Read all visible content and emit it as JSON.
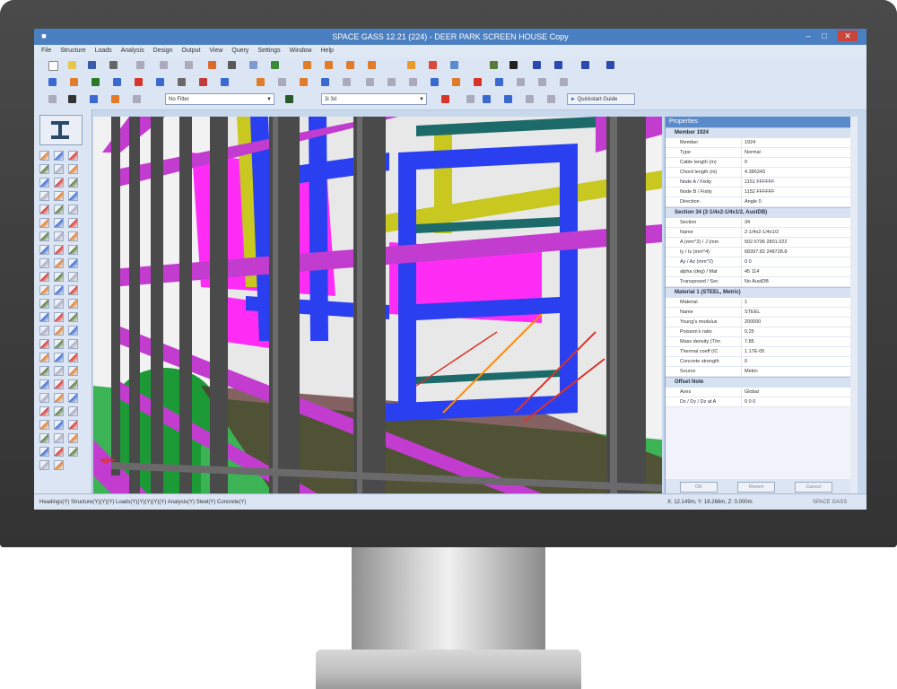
{
  "window": {
    "title": "SPACE GASS 12.21 (224) - DEER PARK SCREEN HOUSE Copy",
    "icon": "app-icon"
  },
  "menu": [
    "File",
    "Structure",
    "Loads",
    "Analysis",
    "Design",
    "Output",
    "View",
    "Query",
    "Settings",
    "Window",
    "Help"
  ],
  "toolbar": {
    "filter1": "No Filter",
    "filter2": "3i 3d",
    "quick_guide": "Quickstart Guide"
  },
  "properties": {
    "title": "Properties",
    "groups": [
      {
        "name": "Member 1924",
        "rows": [
          {
            "key": "Member",
            "value": "1924"
          },
          {
            "key": "Type",
            "value": "Normal"
          },
          {
            "key": "Cable length (m)",
            "value": "0"
          },
          {
            "key": "Chord length (m)",
            "value": "4.386343"
          },
          {
            "key": "Node A / Fixity",
            "value": "1151    FFFFFF"
          },
          {
            "key": "Node B / Fixity",
            "value": "1152    FFFFFF"
          },
          {
            "key": "Direction",
            "value": "Angle   0"
          }
        ]
      },
      {
        "name": "Section 34 (2-1/4x2-1/4x1/2, AustDB)",
        "rows": [
          {
            "key": "Section",
            "value": "34"
          },
          {
            "key": "Name",
            "value": "2-1/4x2-1/4x1/2"
          },
          {
            "key": "A (mm^2) / J (mm",
            "value": "502.5796    2801.022"
          },
          {
            "key": "Iy / Iz (mm^4)",
            "value": "68397.82    248728.8"
          },
          {
            "key": "Ay / Az (mm^2)",
            "value": "0    0"
          },
          {
            "key": "alpha (deg) / Mat",
            "value": "45    114"
          },
          {
            "key": "Transposed / Sec",
            "value": "No    AustDB"
          }
        ]
      },
      {
        "name": "Material 1 (STEEL, Metric)",
        "rows": [
          {
            "key": "Material",
            "value": "1"
          },
          {
            "key": "Name",
            "value": "STEEL"
          },
          {
            "key": "Young's modulus",
            "value": "200000"
          },
          {
            "key": "Poisson's ratio",
            "value": "0.25"
          },
          {
            "key": "Mass density (T/m",
            "value": "7.85"
          },
          {
            "key": "Thermal coeff (/C",
            "value": "1.17E-05"
          },
          {
            "key": "Concrete strength",
            "value": "0"
          },
          {
            "key": "Source",
            "value": "Metric"
          }
        ]
      },
      {
        "name": "Offset Note",
        "rows": [
          {
            "key": "Axes",
            "value": "Global"
          },
          {
            "key": "Dx / Dy / Dz at A",
            "value": "0    0    0"
          }
        ]
      }
    ],
    "buttons": [
      "OK",
      "Revert",
      "Cancel"
    ]
  },
  "status": {
    "left": "Headings(Y) Structure(Y)(Y)(Y) Loads(Y)(Y)(Y)(Y)(Y) Analysis(Y) Steel(Y) Concrete(Y)",
    "coords": "X: 12.149m, Y: 18.266m, Z: 0.000m",
    "right": "SPACE GASS"
  },
  "colors": {
    "magenta": "#c23ccf",
    "pink": "#ff2cf5",
    "blue": "#2a3ff0",
    "yellow": "#c8c820",
    "green": "#1ca83a",
    "dark": "#4a4a4a",
    "teal": "#1c6a6a",
    "orange": "#ff8a00"
  }
}
